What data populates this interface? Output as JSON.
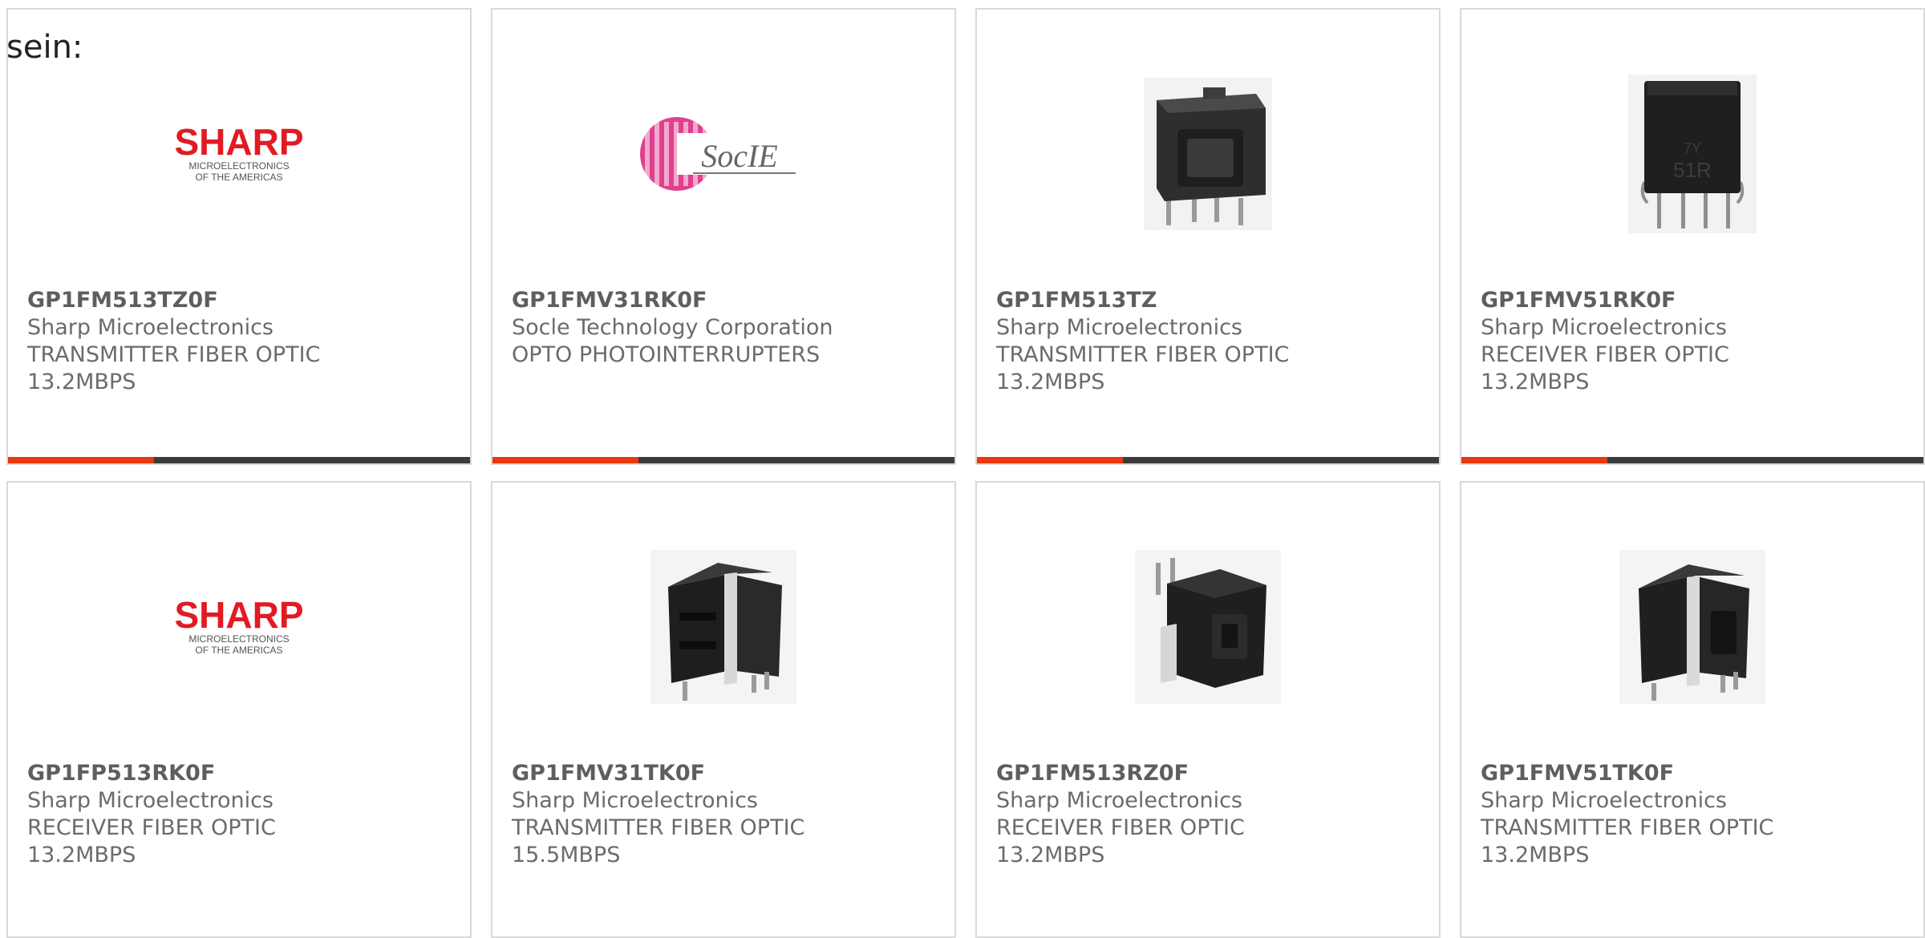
{
  "intro_text": "sein:",
  "colors": {
    "accent": "#e8380d",
    "bar": "#3c3c3c",
    "border": "#d9d9d9",
    "text": "#6b6b6b"
  },
  "products": [
    {
      "part_number": "GP1FM513TZ0F",
      "manufacturer": "Sharp Microelectronics",
      "description_1": "TRANSMITTER FIBER OPTIC",
      "description_2": "13.2MBPS",
      "image": "sharp-logo",
      "logo_text": "SHARP",
      "logo_sub_1": "MICROELECTRONICS",
      "logo_sub_2": "OF THE AMERICAS",
      "has_accent_bar": true
    },
    {
      "part_number": "GP1FMV31RK0F",
      "manufacturer": "Socle Technology Corporation",
      "description_1": "OPTO PHOTOINTERRUPTERS",
      "description_2": "",
      "image": "socle-logo",
      "logo_text": "SocIE",
      "has_accent_bar": true
    },
    {
      "part_number": "GP1FM513TZ",
      "manufacturer": "Sharp Microelectronics",
      "description_1": "TRANSMITTER FIBER OPTIC",
      "description_2": "13.2MBPS",
      "image": "connector-front-photo",
      "has_accent_bar": true
    },
    {
      "part_number": "GP1FMV51RK0F",
      "manufacturer": "Sharp Microelectronics",
      "description_1": "RECEIVER FIBER OPTIC",
      "description_2": "13.2MBPS",
      "image": "receiver-module-photo",
      "has_accent_bar": true
    },
    {
      "part_number": "GP1FP513RK0F",
      "manufacturer": "Sharp Microelectronics",
      "description_1": "RECEIVER FIBER OPTIC",
      "description_2": "13.2MBPS",
      "image": "sharp-logo",
      "logo_text": "SHARP",
      "logo_sub_1": "MICROELECTRONICS",
      "logo_sub_2": "OF THE AMERICAS",
      "has_accent_bar": false
    },
    {
      "part_number": "GP1FMV31TK0F",
      "manufacturer": "Sharp Microelectronics",
      "description_1": "TRANSMITTER FIBER OPTIC",
      "description_2": "15.5MBPS",
      "image": "connector-angled-photo",
      "has_accent_bar": false
    },
    {
      "part_number": "GP1FM513RZ0F",
      "manufacturer": "Sharp Microelectronics",
      "description_1": "RECEIVER FIBER OPTIC",
      "description_2": "13.2MBPS",
      "image": "connector-side-photo",
      "has_accent_bar": false
    },
    {
      "part_number": "GP1FMV51TK0F",
      "manufacturer": "Sharp Microelectronics",
      "description_1": "TRANSMITTER FIBER OPTIC",
      "description_2": "13.2MBPS",
      "image": "connector-angled-photo",
      "has_accent_bar": false
    }
  ]
}
